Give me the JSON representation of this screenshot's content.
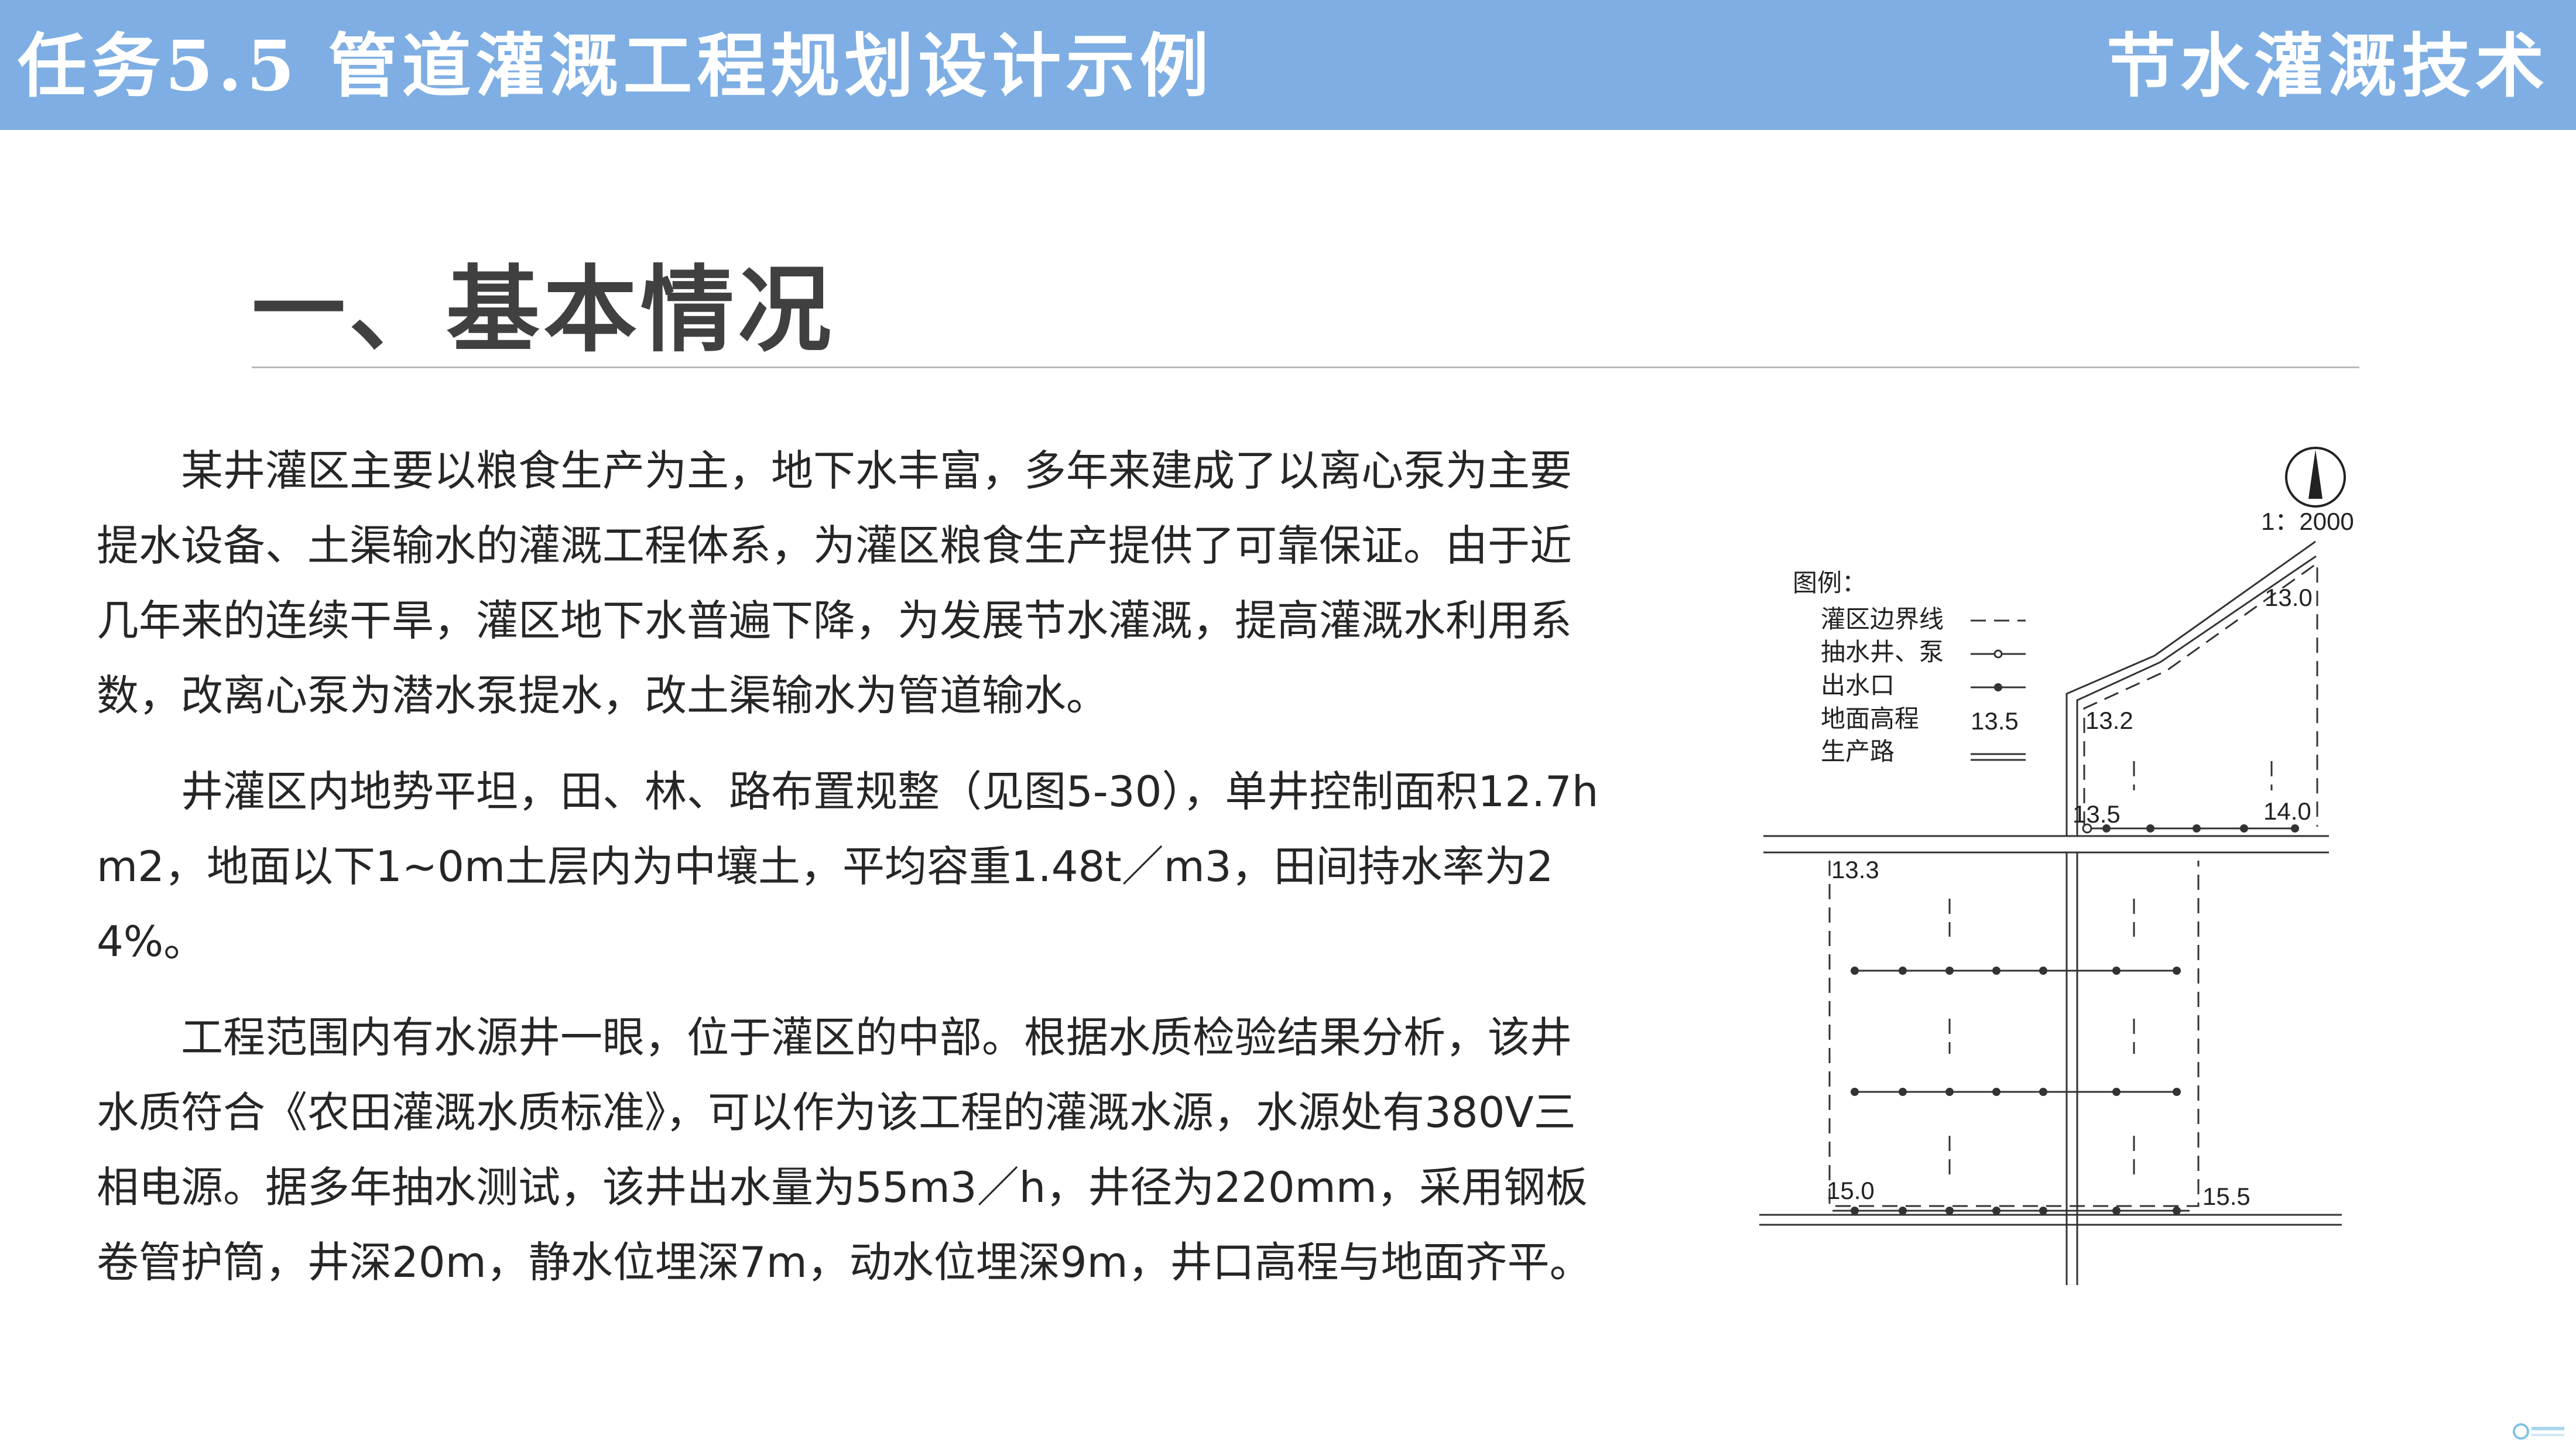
{
  "header": {
    "title": "任务5.5  管道灌溉工程规划设计示例",
    "subject": "节水灌溉技术"
  },
  "section": {
    "heading": "一、基本情况"
  },
  "paragraphs": [
    "某井灌区主要以粮食生产为主，地下水丰富，多年来建成了以离心泵为主要提水设备、土渠输水的灌溉工程体系，为灌区粮食生产提供了可靠保证。由于近几年来的连续干旱，灌区地下水普遍下降，为发展节水灌溉，提高灌溉水利用系数，改离心泵为潜水泵提水，改土渠输水为管道输水。",
    "井灌区内地势平坦，田、林、路布置规整（见图5-30），单井控制面积12.7hm2，地面以下1~0m土层内为中壤土，平均容重1.48t／m3，田间持水率为24%。",
    "工程范围内有水源井一眼，位于灌区的中部。根据水质检验结果分析，该井水质符合《农田灌溉水质标准》，可以作为该工程的灌溉水源，水源处有380V三相电源。据多年抽水测试，该井出水量为55m3／h，井径为220mm，采用钢板卷管护筒，井深20m，静水位埋深7m，动水位埋深9m，井口高程与地面齐平。"
  ],
  "map": {
    "scale": "1：2000",
    "legend_title": "图例：",
    "legend": [
      {
        "label": "灌区边界线"
      },
      {
        "label": "抽水井、泵"
      },
      {
        "label": "出水口"
      },
      {
        "label": "地面高程",
        "sample": "13.5"
      },
      {
        "label": "生产路"
      }
    ],
    "elevations": {
      "e_13_0": "13.0",
      "e_13_2": "13.2",
      "e_13_5": "13.5",
      "e_14_0": "14.0",
      "e_13_3": "13.3",
      "e_15_0": "15.0",
      "e_15_5": "15.5"
    }
  },
  "colors": {
    "header_bg": "#7eaee3",
    "header_text": "#ffffff",
    "heading_text": "#404040",
    "body_text": "#262626"
  }
}
